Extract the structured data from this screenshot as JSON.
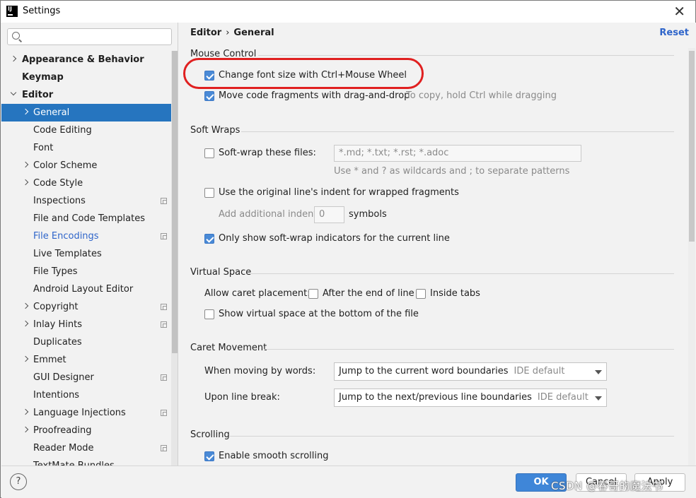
{
  "window": {
    "title": "Settings"
  },
  "search": {
    "placeholder": ""
  },
  "sidebar": {
    "items": [
      {
        "label": "Appearance & Behavior"
      },
      {
        "label": "Keymap"
      },
      {
        "label": "Editor"
      },
      {
        "label": "General"
      },
      {
        "label": "Code Editing"
      },
      {
        "label": "Font"
      },
      {
        "label": "Color Scheme"
      },
      {
        "label": "Code Style"
      },
      {
        "label": "Inspections"
      },
      {
        "label": "File and Code Templates"
      },
      {
        "label": "File Encodings"
      },
      {
        "label": "Live Templates"
      },
      {
        "label": "File Types"
      },
      {
        "label": "Android Layout Editor"
      },
      {
        "label": "Copyright"
      },
      {
        "label": "Inlay Hints"
      },
      {
        "label": "Duplicates"
      },
      {
        "label": "Emmet"
      },
      {
        "label": "GUI Designer"
      },
      {
        "label": "Intentions"
      },
      {
        "label": "Language Injections"
      },
      {
        "label": "Proofreading"
      },
      {
        "label": "Reader Mode"
      },
      {
        "label": "TextMate Bundles"
      }
    ]
  },
  "breadcrumb": {
    "first": "Editor",
    "separator": "›",
    "second": "General"
  },
  "reset_label": "Reset",
  "mouse_control": {
    "title": "Mouse Control",
    "change_font_size": "Change font size with Ctrl+Mouse Wheel",
    "move_fragments": "Move code fragments with drag-and-drop",
    "move_hint": "To copy, hold Ctrl while dragging"
  },
  "soft_wraps": {
    "title": "Soft Wraps",
    "soft_wrap_files": "Soft-wrap these files:",
    "files_value": "*.md; *.txt; *.rst; *.adoc",
    "files_hint": "Use * and ? as wildcards and ; to separate patterns",
    "original_indent": "Use the original line's indent for wrapped fragments",
    "additional_indent": "Add additional indent:",
    "indent_value": "0",
    "symbols": "symbols",
    "indicators": "Only show soft-wrap indicators for the current line"
  },
  "virtual_space": {
    "title": "Virtual Space",
    "allow_caret": "Allow caret placement:",
    "after_end": "After the end of line",
    "inside_tabs": "Inside tabs",
    "show_virtual": "Show virtual space at the bottom of the file"
  },
  "caret_movement": {
    "title": "Caret Movement",
    "moving_words_label": "When moving by words:",
    "moving_words_value": "Jump to the current word boundaries",
    "moving_words_default": "IDE default",
    "line_break_label": "Upon line break:",
    "line_break_value": "Jump to the next/previous line boundaries",
    "line_break_default": "IDE default"
  },
  "scrolling": {
    "title": "Scrolling",
    "smooth": "Enable smooth scrolling"
  },
  "buttons": {
    "help": "?",
    "ok": "OK",
    "cancel": "Cancel",
    "apply": "Apply"
  },
  "watermark": "CSDN @春哥的魔法书",
  "colors": {
    "accent": "#2675bf",
    "link": "#2f65ca",
    "annotation": "#e02020"
  }
}
